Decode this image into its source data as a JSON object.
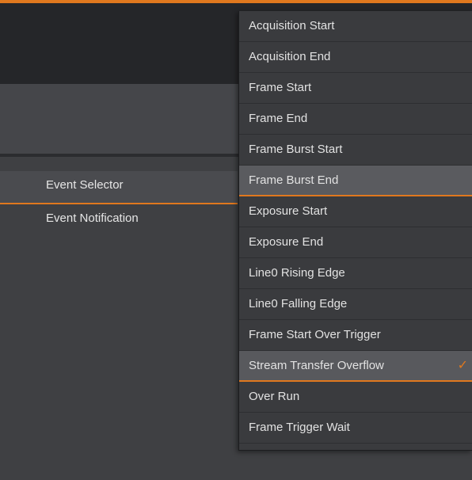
{
  "properties": {
    "event_selector_label": "Event Selector",
    "event_notification_label": "Event Notification"
  },
  "dropdown": {
    "items": [
      {
        "label": "Acquisition Start"
      },
      {
        "label": "Acquisition End"
      },
      {
        "label": "Frame Start"
      },
      {
        "label": "Frame End"
      },
      {
        "label": "Frame Burst Start"
      },
      {
        "label": "Frame Burst End",
        "state": "hover"
      },
      {
        "label": "Exposure Start"
      },
      {
        "label": "Exposure End"
      },
      {
        "label": "Line0 Rising Edge"
      },
      {
        "label": "Line0 Falling Edge"
      },
      {
        "label": "Frame Start Over Trigger"
      },
      {
        "label": "Stream Transfer Overflow",
        "state": "selected"
      },
      {
        "label": "Over Run"
      },
      {
        "label": "Frame Trigger Wait"
      }
    ],
    "check_glyph": "✓"
  },
  "colors": {
    "accent": "#e0781e",
    "background": "#3d3e41",
    "dropdown_bg": "#3a3b3e",
    "text": "#e2e2e2"
  },
  "icons": {
    "selected_indicator": "check-icon"
  }
}
